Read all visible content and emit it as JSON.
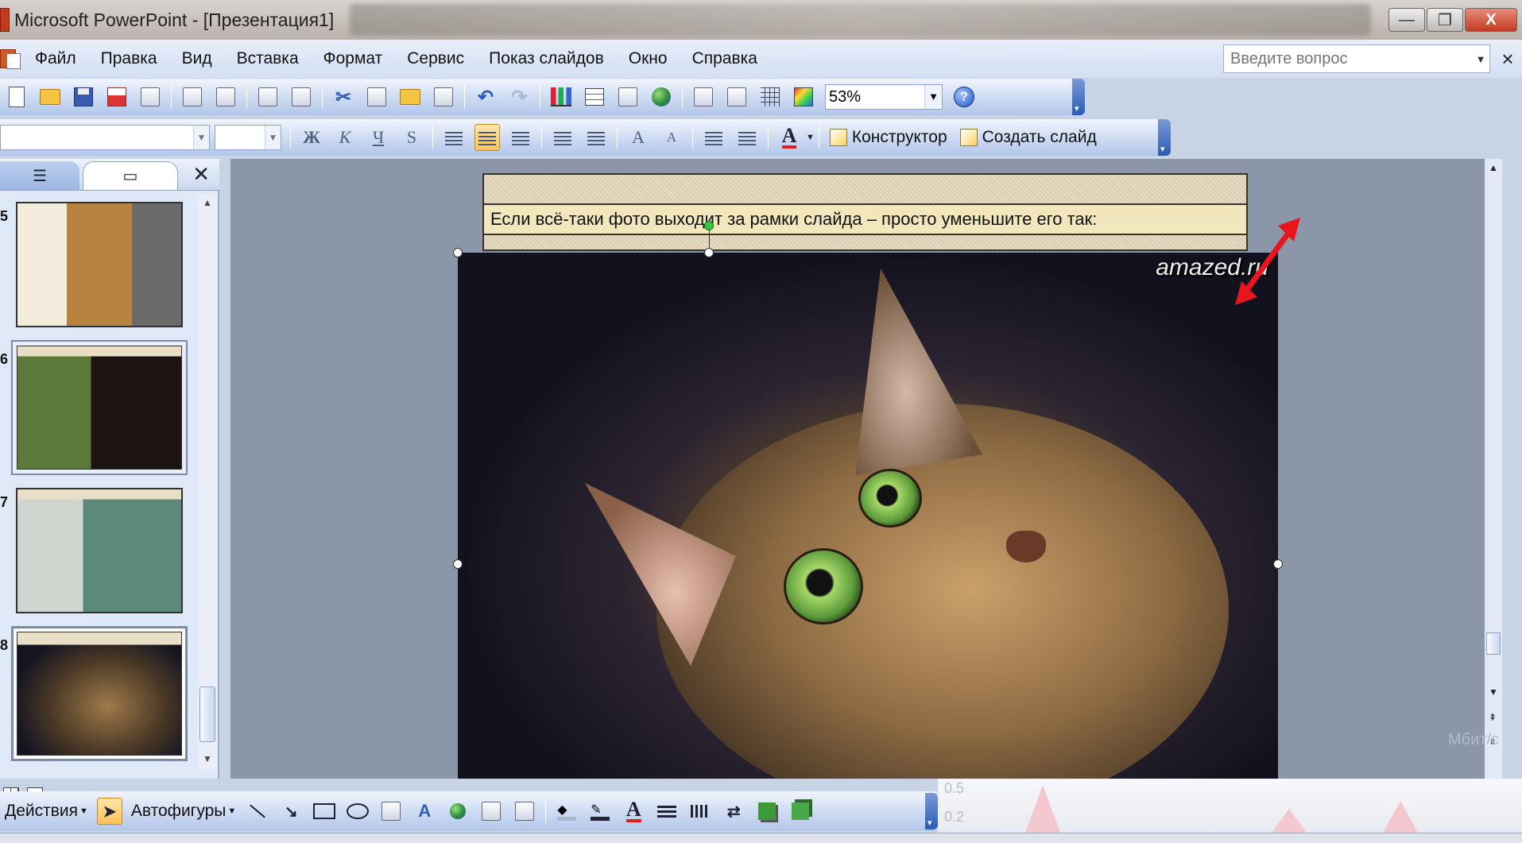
{
  "window": {
    "title": "Microsoft PowerPoint - [Презентация1]",
    "buttons": {
      "minimize": "—",
      "restore": "❐",
      "close": "X"
    }
  },
  "menubar": {
    "items": [
      "Файл",
      "Правка",
      "Вид",
      "Вставка",
      "Формат",
      "Сервис",
      "Показ слайдов",
      "Окно",
      "Справка"
    ],
    "help_placeholder": "Введите вопрос",
    "close": "×"
  },
  "toolbar_standard": {
    "zoom": "53%"
  },
  "toolbar_formatting": {
    "bold": "Ж",
    "italic": "К",
    "underline": "Ч",
    "shadow": "S",
    "increase_font": "A",
    "decrease_font": "A",
    "font_color": "A",
    "designer_label": "Конструктор",
    "new_slide_label": "Создать слайд"
  },
  "slides_pane": {
    "tab_close": "✕",
    "thumbnails": [
      {
        "number": "5"
      },
      {
        "number": "6"
      },
      {
        "number": "7"
      },
      {
        "number": "8"
      }
    ]
  },
  "slide": {
    "caption": "Если всё-таки фото выходит за рамки слайда – просто уменьшите его так:",
    "photo_watermark": "amazed.ru"
  },
  "drawing_toolbar": {
    "actions_label": "Действия",
    "autoshapes_label": "Автофигуры"
  },
  "background": {
    "chart_ticks": [
      "0.5",
      "0.2"
    ],
    "label": "Мбит/с"
  },
  "colors": {
    "accent_arrow": "#e8141e",
    "slide_area_bg": "#8b96a8",
    "caption_bg": "#f2e6bd"
  }
}
